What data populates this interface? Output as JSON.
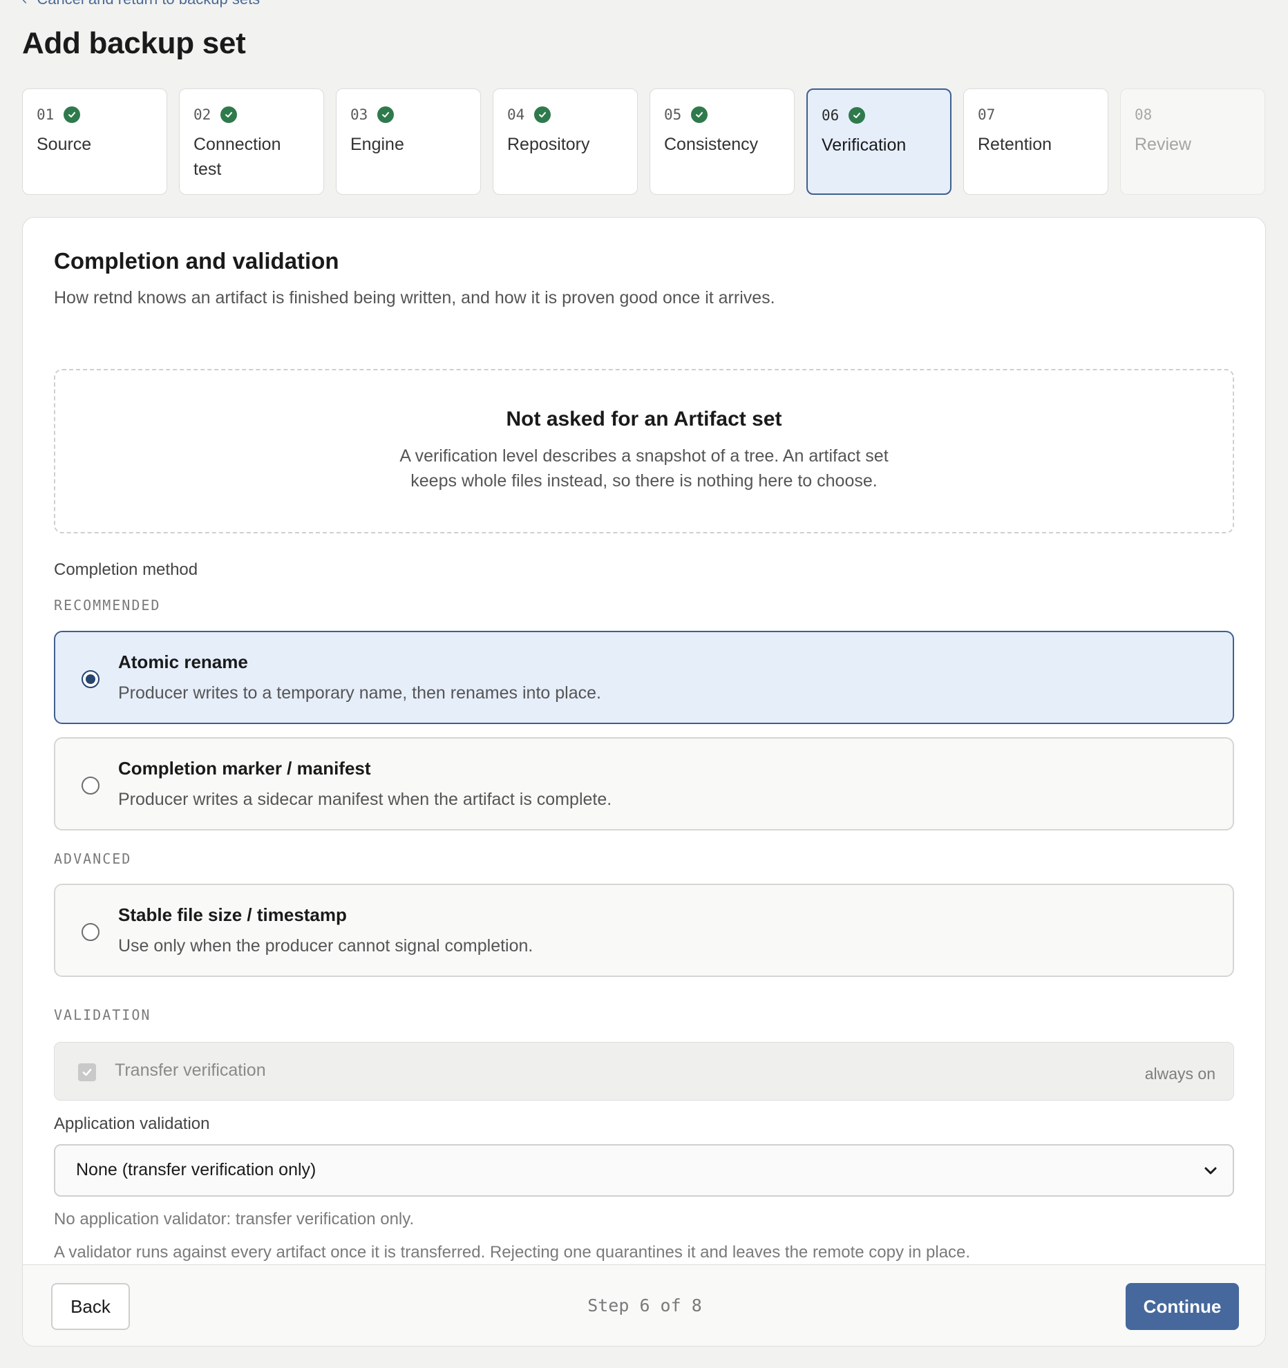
{
  "nav": {
    "back_label": "Cancel and return to backup sets"
  },
  "page": {
    "title": "Add backup set"
  },
  "steps": [
    {
      "num": "01",
      "label": "Source",
      "done": true
    },
    {
      "num": "02",
      "label": "Connection test",
      "done": true
    },
    {
      "num": "03",
      "label": "Engine",
      "done": true
    },
    {
      "num": "04",
      "label": "Repository",
      "done": true
    },
    {
      "num": "05",
      "label": "Consistency",
      "done": true
    },
    {
      "num": "06",
      "label": "Verification",
      "done": true,
      "active": true
    },
    {
      "num": "07",
      "label": "Retention",
      "done": false
    },
    {
      "num": "08",
      "label": "Review",
      "done": false,
      "disabled": true
    }
  ],
  "section": {
    "title": "Completion and validation",
    "description": "How retnd knows an artifact is finished being written, and how it is proven good once it arrives."
  },
  "notice": {
    "title": "Not asked for an Artifact set",
    "text": "A verification level describes a snapshot of a tree. An artifact set keeps whole files instead, so there is nothing here to choose."
  },
  "completion": {
    "label": "Completion method",
    "recommended_label": "RECOMMENDED",
    "advanced_label": "ADVANCED",
    "options": [
      {
        "title": "Atomic rename",
        "desc": "Producer writes to a temporary name, then renames into place.",
        "selected": true
      },
      {
        "title": "Completion marker / manifest",
        "desc": "Producer writes a sidecar manifest when the artifact is complete.",
        "selected": false
      },
      {
        "title": "Stable file size / timestamp",
        "desc": "Use only when the producer cannot signal completion.",
        "selected": false
      }
    ]
  },
  "validation": {
    "group_label": "VALIDATION",
    "transfer_label": "Transfer verification",
    "transfer_checked": true,
    "always_on": "always on",
    "app_label": "Application validation",
    "app_value": "None (transfer verification only)",
    "hint1": "No application validator: transfer verification only.",
    "hint2": "A validator runs against every artifact once it is transferred. Rejecting one quarantines it and leaves the remote copy in place."
  },
  "footer": {
    "back": "Back",
    "step_text": "Step 6 of 8",
    "continue": "Continue"
  },
  "colors": {
    "accent": "#46689c",
    "selected_bg": "#e6eefa",
    "success": "#2f7a4c"
  }
}
